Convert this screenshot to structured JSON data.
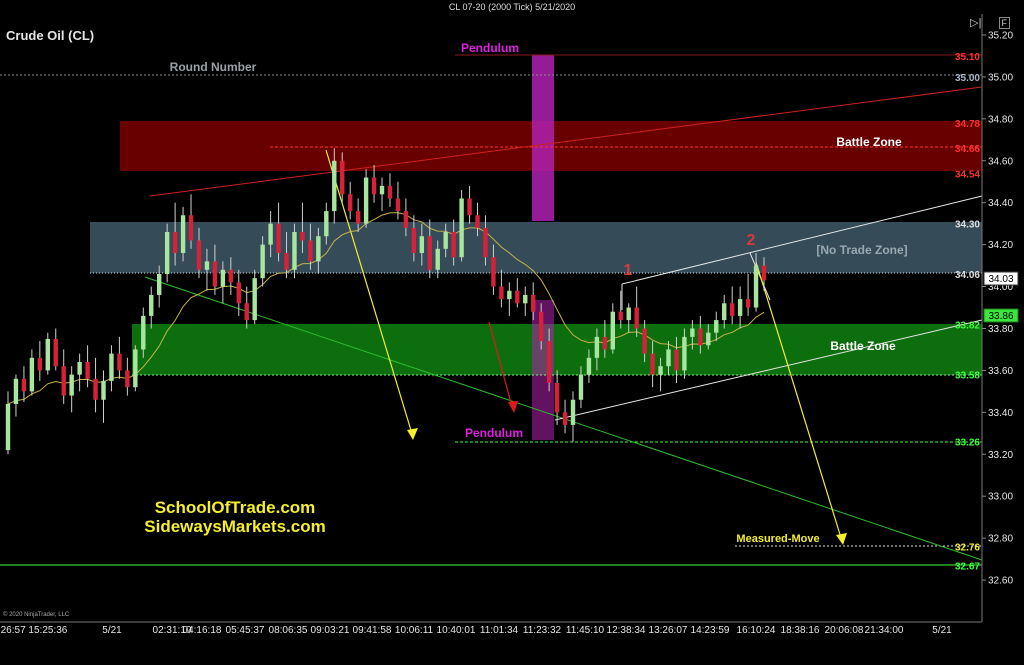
{
  "window": {
    "title": "CL 07-20 (2000 Tick)  5/21/2020",
    "instrument": "Crude Oil (CL)",
    "copyright": "© 2020 NinjaTrader, LLC",
    "icons": [
      "play-icon",
      "f-icon"
    ],
    "f_label": "F"
  },
  "watermark": {
    "line1": "SchoolOfTrade.com",
    "line2": "SidewaysMarkets.com"
  },
  "colors": {
    "background": "#000000",
    "candle_up": "#a8e6a0",
    "candle_down": "#d6213a",
    "battle_red": "#6e0000",
    "no_trade": "#3e5866",
    "battle_green": "#0e7a10",
    "pendulum": "#b020b0",
    "yellow": "#f5ee2a",
    "ema": "#c6b34a"
  },
  "chart_data": {
    "type": "candlestick",
    "ylim": [
      32.4,
      35.3
    ],
    "y_ticks": [
      32.6,
      32.8,
      33.0,
      33.2,
      33.4,
      33.6,
      33.8,
      34.0,
      34.2,
      34.4,
      34.6,
      34.8,
      35.0,
      35.2
    ],
    "x_labels": [
      "26:57 15:25:36",
      "5/21",
      "02:31:10",
      "04:16:18",
      "05:45:37",
      "08:06:35",
      "09:03:21",
      "09:41:58",
      "10:06:11",
      "10:40:01",
      "11:01:34",
      "11:23:32",
      "11:45:10",
      "12:38:34",
      "13:26:07",
      "14:23:59",
      "16:10:24",
      "18:38:16",
      "20:06:08",
      "21:34:00",
      "5/21"
    ],
    "last_price": "34.03",
    "last_price_marker": "33.86",
    "zones": [
      {
        "label": "Battle Zone",
        "from": 34.54,
        "to": 34.78,
        "color": "#6e0000"
      },
      {
        "label": "[No Trade Zone]",
        "from": 34.06,
        "to": 34.3,
        "color": "#3e5866"
      },
      {
        "label": "Battle Zone",
        "from": 33.58,
        "to": 33.82,
        "color": "#0e7a10"
      }
    ],
    "level_labels": [
      {
        "value": 35.1,
        "text": "35.10",
        "color": "#ff3030"
      },
      {
        "value": 35.0,
        "text": "35.00",
        "color": "#aab4c8"
      },
      {
        "value": 34.78,
        "text": "34.78",
        "color": "#ff3030"
      },
      {
        "value": 34.66,
        "text": "34.66",
        "color": "#ff3030"
      },
      {
        "value": 34.54,
        "text": "34.54",
        "color": "#ff3030"
      },
      {
        "value": 34.3,
        "text": "34.30",
        "color": "#dddddd"
      },
      {
        "value": 34.06,
        "text": "34.06",
        "color": "#dddddd"
      },
      {
        "value": 33.82,
        "text": "33.82",
        "color": "#3dff3d"
      },
      {
        "value": 33.58,
        "text": "33.58",
        "color": "#3dff3d"
      },
      {
        "value": 33.26,
        "text": "33.26",
        "color": "#3dff3d"
      },
      {
        "value": 32.76,
        "text": "32.76",
        "color": "#f5ee2a"
      },
      {
        "value": 32.67,
        "text": "32.67",
        "color": "#3dff3d"
      }
    ],
    "annotations": [
      {
        "text": "Pendulum",
        "color": "#e020e0"
      },
      {
        "text": "Round Number",
        "color": "#9aa0a8"
      },
      {
        "text": "Battle Zone",
        "color": "#ffffff"
      },
      {
        "text": "[No Trade Zone]",
        "color": "#9aa8b0"
      },
      {
        "text": "Battle Zone",
        "color": "#ffffff"
      },
      {
        "text": "Pendulum",
        "color": "#e020e0"
      },
      {
        "text": "Measured-Move",
        "color": "#f5ee2a"
      },
      {
        "text": "1",
        "color": "#d83a3a"
      },
      {
        "text": "2",
        "color": "#d83a3a"
      }
    ],
    "candles": [
      [
        33.22,
        33.5,
        33.2,
        33.44
      ],
      [
        33.44,
        33.58,
        33.38,
        33.56
      ],
      [
        33.56,
        33.62,
        33.45,
        33.5
      ],
      [
        33.5,
        33.7,
        33.48,
        33.66
      ],
      [
        33.66,
        33.74,
        33.55,
        33.6
      ],
      [
        33.6,
        33.78,
        33.58,
        33.75
      ],
      [
        33.75,
        33.8,
        33.6,
        33.62
      ],
      [
        33.62,
        33.7,
        33.44,
        33.48
      ],
      [
        33.48,
        33.62,
        33.4,
        33.58
      ],
      [
        33.58,
        33.68,
        33.5,
        33.64
      ],
      [
        33.64,
        33.72,
        33.52,
        33.56
      ],
      [
        33.56,
        33.66,
        33.4,
        33.46
      ],
      [
        33.46,
        33.6,
        33.35,
        33.55
      ],
      [
        33.55,
        33.72,
        33.5,
        33.68
      ],
      [
        33.68,
        33.76,
        33.56,
        33.6
      ],
      [
        33.6,
        33.66,
        33.48,
        33.52
      ],
      [
        33.52,
        33.72,
        33.5,
        33.7
      ],
      [
        33.7,
        33.9,
        33.66,
        33.86
      ],
      [
        33.86,
        34.0,
        33.8,
        33.96
      ],
      [
        33.96,
        34.1,
        33.9,
        34.06
      ],
      [
        34.06,
        34.3,
        34.02,
        34.26
      ],
      [
        34.26,
        34.4,
        34.1,
        34.16
      ],
      [
        34.16,
        34.38,
        34.12,
        34.34
      ],
      [
        34.34,
        34.44,
        34.18,
        34.22
      ],
      [
        34.22,
        34.28,
        34.04,
        34.08
      ],
      [
        34.08,
        34.18,
        33.98,
        34.12
      ],
      [
        34.12,
        34.2,
        33.96,
        34.0
      ],
      [
        34.0,
        34.12,
        33.92,
        34.08
      ],
      [
        34.08,
        34.14,
        33.96,
        34.02
      ],
      [
        34.02,
        34.08,
        33.86,
        33.92
      ],
      [
        33.92,
        34.0,
        33.8,
        33.84
      ],
      [
        33.84,
        34.08,
        33.82,
        34.04
      ],
      [
        34.04,
        34.24,
        34.0,
        34.2
      ],
      [
        34.2,
        34.36,
        34.14,
        34.3
      ],
      [
        34.3,
        34.4,
        34.12,
        34.16
      ],
      [
        34.16,
        34.26,
        34.04,
        34.08
      ],
      [
        34.08,
        34.3,
        34.04,
        34.26
      ],
      [
        34.26,
        34.4,
        34.16,
        34.22
      ],
      [
        34.22,
        34.3,
        34.08,
        34.12
      ],
      [
        34.12,
        34.28,
        34.06,
        34.24
      ],
      [
        34.24,
        34.4,
        34.2,
        34.36
      ],
      [
        34.36,
        34.66,
        34.3,
        34.6
      ],
      [
        34.6,
        34.64,
        34.4,
        34.44
      ],
      [
        34.44,
        34.5,
        34.32,
        34.36
      ],
      [
        34.36,
        34.42,
        34.26,
        34.3
      ],
      [
        34.3,
        34.56,
        34.28,
        34.52
      ],
      [
        34.52,
        34.58,
        34.4,
        34.44
      ],
      [
        34.44,
        34.52,
        34.36,
        34.48
      ],
      [
        34.48,
        34.54,
        34.38,
        34.42
      ],
      [
        34.42,
        34.5,
        34.32,
        34.36
      ],
      [
        34.36,
        34.42,
        34.24,
        34.28
      ],
      [
        34.28,
        34.34,
        34.12,
        34.16
      ],
      [
        34.16,
        34.3,
        34.1,
        34.24
      ],
      [
        34.24,
        34.32,
        34.04,
        34.08
      ],
      [
        34.08,
        34.22,
        34.04,
        34.18
      ],
      [
        34.18,
        34.3,
        34.14,
        34.26
      ],
      [
        34.26,
        34.32,
        34.1,
        34.14
      ],
      [
        34.14,
        34.46,
        34.12,
        34.42
      ],
      [
        34.42,
        34.48,
        34.3,
        34.34
      ],
      [
        34.34,
        34.4,
        34.24,
        34.28
      ],
      [
        34.28,
        34.34,
        34.1,
        34.14
      ],
      [
        34.14,
        34.2,
        33.96,
        34.0
      ],
      [
        34.0,
        34.08,
        33.9,
        33.94
      ],
      [
        33.94,
        34.02,
        33.86,
        33.98
      ],
      [
        33.98,
        34.04,
        33.9,
        33.92
      ],
      [
        33.92,
        34.0,
        33.86,
        33.96
      ],
      [
        33.96,
        34.02,
        33.84,
        33.88
      ],
      [
        33.88,
        33.92,
        33.7,
        33.74
      ],
      [
        33.74,
        33.8,
        33.5,
        33.54
      ],
      [
        33.54,
        33.6,
        33.34,
        33.4
      ],
      [
        33.4,
        33.46,
        33.3,
        33.34
      ],
      [
        33.34,
        33.5,
        33.26,
        33.46
      ],
      [
        33.46,
        33.62,
        33.42,
        33.58
      ],
      [
        33.58,
        33.7,
        33.54,
        33.66
      ],
      [
        33.66,
        33.8,
        33.6,
        33.76
      ],
      [
        33.76,
        33.84,
        33.66,
        33.7
      ],
      [
        33.7,
        33.92,
        33.68,
        33.88
      ],
      [
        33.88,
        33.98,
        33.8,
        33.84
      ],
      [
        33.84,
        33.92,
        33.78,
        33.9
      ],
      [
        33.9,
        34.0,
        33.76,
        33.8
      ],
      [
        33.8,
        33.84,
        33.64,
        33.68
      ],
      [
        33.68,
        33.74,
        33.52,
        33.58
      ],
      [
        33.58,
        33.66,
        33.5,
        33.62
      ],
      [
        33.62,
        33.74,
        33.58,
        33.7
      ],
      [
        33.7,
        33.76,
        33.54,
        33.6
      ],
      [
        33.6,
        33.8,
        33.56,
        33.76
      ],
      [
        33.76,
        33.84,
        33.7,
        33.8
      ],
      [
        33.8,
        33.86,
        33.68,
        33.72
      ],
      [
        33.72,
        33.82,
        33.7,
        33.78
      ],
      [
        33.78,
        33.88,
        33.74,
        33.84
      ],
      [
        33.84,
        33.96,
        33.8,
        33.92
      ],
      [
        33.92,
        34.0,
        33.82,
        33.86
      ],
      [
        33.86,
        34.0,
        33.8,
        33.94
      ],
      [
        33.94,
        34.06,
        33.86,
        33.9
      ],
      [
        33.9,
        34.16,
        33.88,
        34.1
      ],
      [
        34.1,
        34.14,
        33.98,
        34.03
      ]
    ]
  }
}
